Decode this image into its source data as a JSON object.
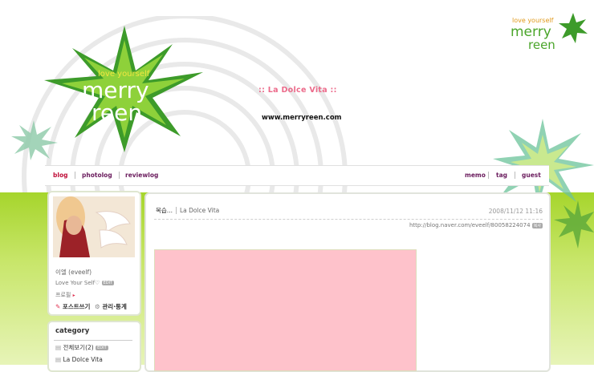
{
  "header": {
    "logo_tagline": "love yourself",
    "logo_line1": "merry",
    "logo_line2": "reen",
    "site_title": ":: La Dolce Vita ::",
    "site_url": "www.merryreen.com"
  },
  "nav": {
    "left": [
      "blog",
      "photolog",
      "reviewlog"
    ],
    "right": [
      "memo",
      "tag",
      "guest"
    ]
  },
  "profile": {
    "name": "이엘 (eveelf)",
    "line2": "Love Your Self♡",
    "line2_badge": "EDIT",
    "line3": "프로필",
    "line3_dot": "▸",
    "write_button": "포스트쓰기",
    "manage_button": "관리·통계"
  },
  "category": {
    "title": "category",
    "items": [
      {
        "label": "전체보기",
        "count": "(2)",
        "badge": "EDIT"
      },
      {
        "label": "La Dolce Vita"
      }
    ]
  },
  "post": {
    "title": "복습...",
    "category": "La Dolce Vita",
    "date": "2008/11/12 11:16",
    "url": "http://blog.naver.com/eveelf/80058224074",
    "url_badge": "복사"
  },
  "colors": {
    "accent_pink": "#ec6a8a",
    "green": "#a6d52c",
    "nav_red": "#c0103a",
    "nav_purple": "#6b1d5e"
  }
}
